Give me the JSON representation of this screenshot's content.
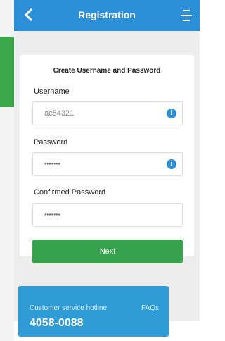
{
  "header": {
    "title": "Registration",
    "back_icon": "chevron-left-icon",
    "menu_icon": "menu-icon"
  },
  "form": {
    "heading": "Create Username and Password",
    "username": {
      "label": "Username",
      "value": "ac54321"
    },
    "password": {
      "label": "Password",
      "value": "•••••••"
    },
    "confirm": {
      "label": "Confirmed Password",
      "value": "•••••••"
    },
    "next_label": "Next"
  },
  "footer": {
    "hotline_label": "Customer service hotline",
    "faq_label": "FAQs",
    "hotline_number": "4058-0088"
  },
  "colors": {
    "header_blue": "#2b8fd8",
    "button_green": "#36a24b",
    "hotline_blue": "#2e9ad6"
  }
}
